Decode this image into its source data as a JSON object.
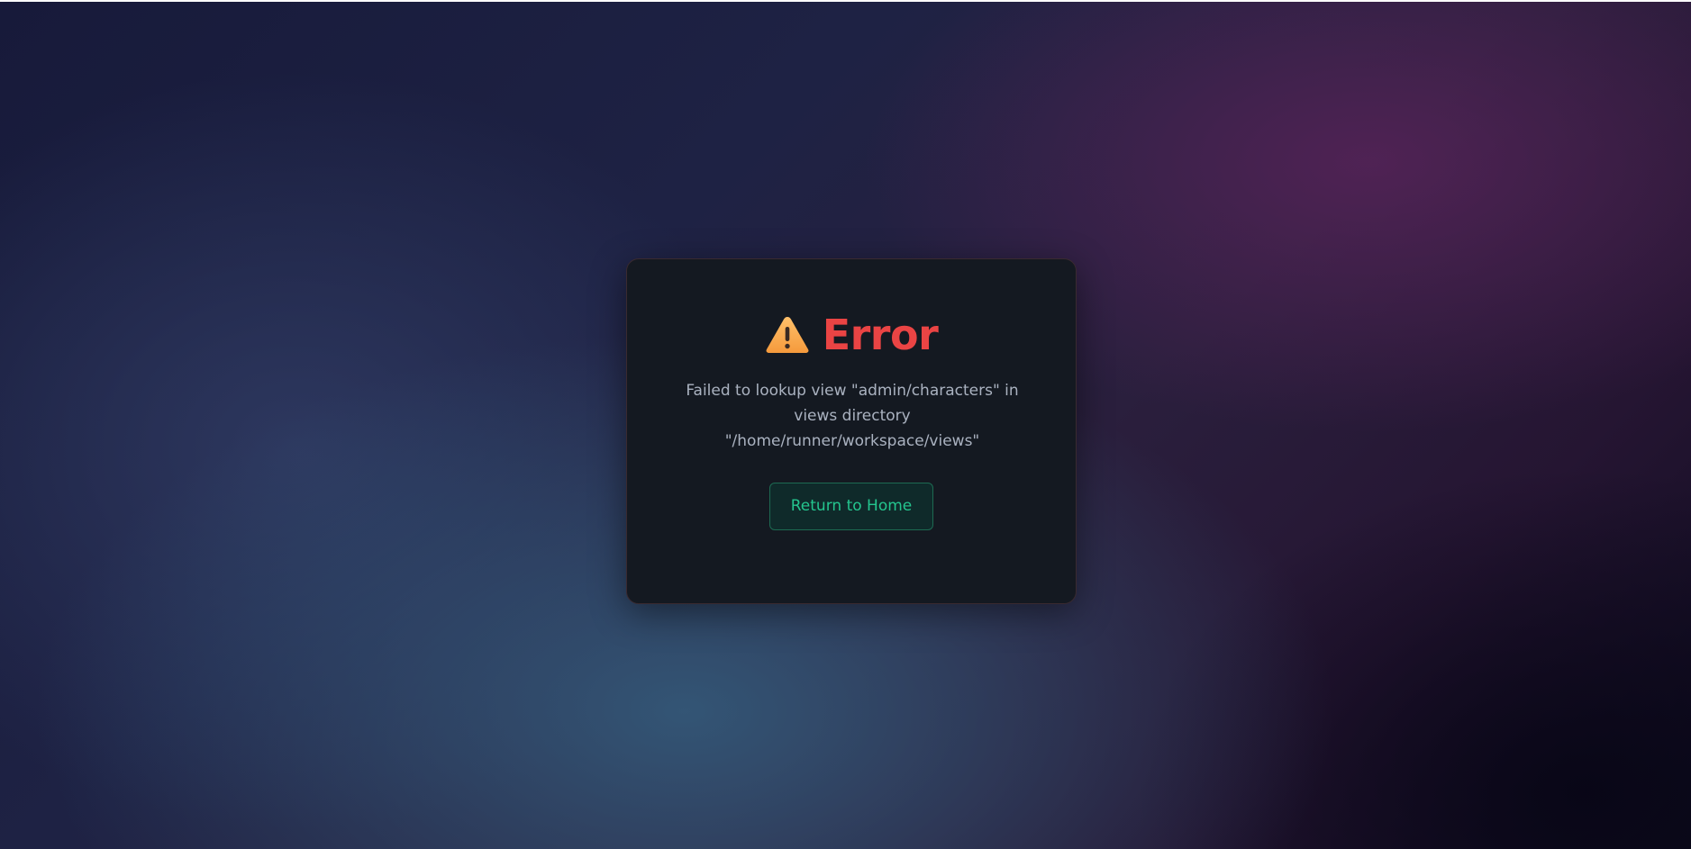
{
  "error": {
    "icon": "warning-icon",
    "title": "Error",
    "message": "Failed to lookup view \"admin/characters\" in views directory \"/home/runner/workspace/views\"",
    "button_label": "Return to Home"
  },
  "colors": {
    "title": "#ea4444",
    "message": "#aab2c0",
    "button_text": "#24c58e",
    "button_border": "#1d6a52",
    "card_background": "#141921",
    "warning_icon": "#f7a44a"
  }
}
